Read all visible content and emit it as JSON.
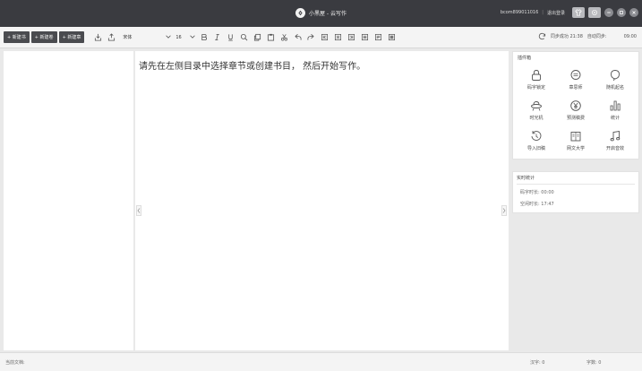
{
  "titlebar": {
    "app_title": "小黑屋 - 云写作",
    "user": "bcom899011016",
    "separator": "|",
    "logout": "退出登录"
  },
  "toolbar": {
    "new_book": "+ 新建书",
    "new_volume": "+ 新建卷",
    "new_chapter": "+ 新建章",
    "font_name": "宋体",
    "font_size": "16",
    "sync_status": "同步成功 21:38",
    "auto_sync_label": "自动同步:",
    "auto_sync_time": "09:00"
  },
  "editor": {
    "hint": "请先在左侧目录中选择章节或创建书目， 然后开始写作。"
  },
  "plugins": {
    "title": "插件箱",
    "items": [
      {
        "label": "码字锁定",
        "icon": "lock-icon"
      },
      {
        "label": "章思师",
        "icon": "chat-icon"
      },
      {
        "label": "随机起名",
        "icon": "balloon-icon"
      },
      {
        "label": "时光机",
        "icon": "ufo-icon"
      },
      {
        "label": "预测稿费",
        "icon": "yen-icon"
      },
      {
        "label": "统计",
        "icon": "bar-chart-icon"
      },
      {
        "label": "导入旧稿",
        "icon": "history-icon"
      },
      {
        "label": "网文大学",
        "icon": "book-icon"
      },
      {
        "label": "开启音效",
        "icon": "music-icon"
      }
    ]
  },
  "stats": {
    "title": "实时统计",
    "typing_time": "码字时长: 00:00",
    "idle_time": "空闲时长: 17:47"
  },
  "statusbar": {
    "current_doc": "当前文档:",
    "word_count": "汉字: 0",
    "char_count": "字数: 0"
  }
}
